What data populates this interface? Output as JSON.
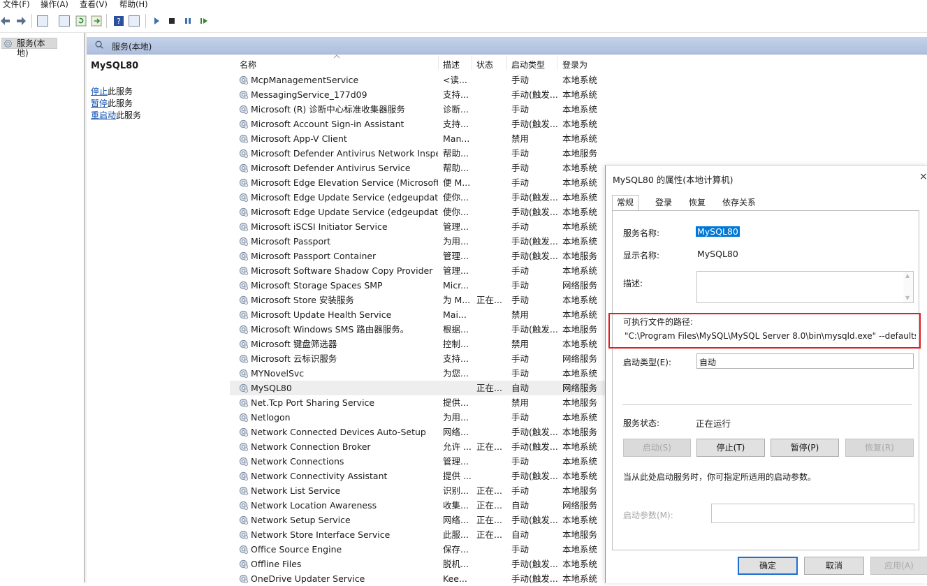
{
  "menu": [
    "文件(F)",
    "操作(A)",
    "查看(V)",
    "帮助(H)"
  ],
  "tree": {
    "root_label": "服务(本地)"
  },
  "main_header": {
    "label": "服务(本地)"
  },
  "detail": {
    "title": "MySQL80",
    "actions": [
      {
        "link": "停止",
        "rest": "此服务"
      },
      {
        "link": "暂停",
        "rest": "此服务"
      },
      {
        "link": "重启动",
        "rest": "此服务"
      }
    ]
  },
  "columns": {
    "name": "名称",
    "desc": "描述",
    "status": "状态",
    "startup": "启动类型",
    "logon": "登录为"
  },
  "rows": [
    {
      "name": "McpManagementService",
      "desc": "<读...",
      "status": "",
      "startup": "手动",
      "logon": "本地系统"
    },
    {
      "name": "MessagingService_177d09",
      "desc": "支持...",
      "status": "",
      "startup": "手动(触发...",
      "logon": "本地系统"
    },
    {
      "name": "Microsoft (R) 诊断中心标准收集器服务",
      "desc": "诊断...",
      "status": "",
      "startup": "手动",
      "logon": "本地系统"
    },
    {
      "name": "Microsoft Account Sign-in Assistant",
      "desc": "支持...",
      "status": "",
      "startup": "手动(触发...",
      "logon": "本地系统"
    },
    {
      "name": "Microsoft App-V Client",
      "desc": "Man...",
      "status": "",
      "startup": "禁用",
      "logon": "本地系统"
    },
    {
      "name": "Microsoft Defender Antivirus Network Inspe...",
      "desc": "帮助...",
      "status": "",
      "startup": "手动",
      "logon": "本地服务"
    },
    {
      "name": "Microsoft Defender Antivirus Service",
      "desc": "帮助...",
      "status": "",
      "startup": "手动",
      "logon": "本地系统"
    },
    {
      "name": "Microsoft Edge Elevation Service (Microsoft...",
      "desc": "便 M...",
      "status": "",
      "startup": "手动",
      "logon": "本地系统"
    },
    {
      "name": "Microsoft Edge Update Service (edgeupdate)",
      "desc": "使你...",
      "status": "",
      "startup": "手动(触发...",
      "logon": "本地系统"
    },
    {
      "name": "Microsoft Edge Update Service (edgeupdat...",
      "desc": "使你...",
      "status": "",
      "startup": "手动(触发...",
      "logon": "本地系统"
    },
    {
      "name": "Microsoft iSCSI Initiator Service",
      "desc": "管理...",
      "status": "",
      "startup": "手动",
      "logon": "本地系统"
    },
    {
      "name": "Microsoft Passport",
      "desc": "为用...",
      "status": "",
      "startup": "手动(触发...",
      "logon": "本地系统"
    },
    {
      "name": "Microsoft Passport Container",
      "desc": "管理...",
      "status": "",
      "startup": "手动(触发...",
      "logon": "本地服务"
    },
    {
      "name": "Microsoft Software Shadow Copy Provider",
      "desc": "管理...",
      "status": "",
      "startup": "手动",
      "logon": "本地系统"
    },
    {
      "name": "Microsoft Storage Spaces SMP",
      "desc": "Micr...",
      "status": "",
      "startup": "手动",
      "logon": "网络服务"
    },
    {
      "name": "Microsoft Store 安装服务",
      "desc": "为 M...",
      "status": "正在...",
      "startup": "手动",
      "logon": "本地系统"
    },
    {
      "name": "Microsoft Update Health Service",
      "desc": "Mai...",
      "status": "",
      "startup": "禁用",
      "logon": "本地系统"
    },
    {
      "name": "Microsoft Windows SMS 路由器服务。",
      "desc": "根据...",
      "status": "",
      "startup": "手动(触发...",
      "logon": "本地服务"
    },
    {
      "name": "Microsoft 键盘筛选器",
      "desc": "控制...",
      "status": "",
      "startup": "禁用",
      "logon": "本地系统"
    },
    {
      "name": "Microsoft 云标识服务",
      "desc": "支持...",
      "status": "",
      "startup": "手动",
      "logon": "网络服务"
    },
    {
      "name": "MYNovelSvc",
      "desc": "为您...",
      "status": "",
      "startup": "手动",
      "logon": "本地系统"
    },
    {
      "name": "MySQL80",
      "desc": "",
      "status": "正在...",
      "startup": "自动",
      "logon": "网络服务"
    },
    {
      "name": "Net.Tcp Port Sharing Service",
      "desc": "提供...",
      "status": "",
      "startup": "禁用",
      "logon": "本地服务"
    },
    {
      "name": "Netlogon",
      "desc": "为用...",
      "status": "",
      "startup": "手动",
      "logon": "本地系统"
    },
    {
      "name": "Network Connected Devices Auto-Setup",
      "desc": "网络...",
      "status": "",
      "startup": "手动(触发...",
      "logon": "本地服务"
    },
    {
      "name": "Network Connection Broker",
      "desc": "允许 ...",
      "status": "正在...",
      "startup": "手动(触发...",
      "logon": "本地系统"
    },
    {
      "name": "Network Connections",
      "desc": "管理...",
      "status": "",
      "startup": "手动",
      "logon": "本地系统"
    },
    {
      "name": "Network Connectivity Assistant",
      "desc": "提供 ...",
      "status": "",
      "startup": "手动(触发...",
      "logon": "本地系统"
    },
    {
      "name": "Network List Service",
      "desc": "识别...",
      "status": "正在...",
      "startup": "手动",
      "logon": "本地服务"
    },
    {
      "name": "Network Location Awareness",
      "desc": "收集...",
      "status": "正在...",
      "startup": "自动",
      "logon": "网络服务"
    },
    {
      "name": "Network Setup Service",
      "desc": "网络...",
      "status": "正在...",
      "startup": "手动(触发...",
      "logon": "本地系统"
    },
    {
      "name": "Network Store Interface Service",
      "desc": "此服...",
      "status": "正在...",
      "startup": "自动",
      "logon": "本地服务"
    },
    {
      "name": "Office  Source Engine",
      "desc": "保存...",
      "status": "",
      "startup": "手动",
      "logon": "本地系统"
    },
    {
      "name": "Offline Files",
      "desc": "脱机...",
      "status": "",
      "startup": "手动(触发...",
      "logon": "本地系统"
    },
    {
      "name": "OneDrive Updater Service",
      "desc": "Kee...",
      "status": "",
      "startup": "手动(触发...",
      "logon": "本地系统"
    }
  ],
  "dialog": {
    "title": "MySQL80 的属性(本地计算机)",
    "close": "×",
    "tabs": [
      "常规",
      "登录",
      "恢复",
      "依存关系"
    ],
    "service_name_label": "服务名称:",
    "service_name_value": "MySQL80",
    "display_name_label": "显示名称:",
    "display_name_value": "MySQL80",
    "description_label": "描述:",
    "path_label": "可执行文件的路径:",
    "path_value": "\"C:\\Program Files\\MySQL\\MySQL Server 8.0\\bin\\mysqld.exe\" --defaults-",
    "startup_type_label": "启动类型(E):",
    "startup_type_value": "自动",
    "status_label": "服务状态:",
    "status_value": "正在运行",
    "btn_start": "启动(S)",
    "btn_stop": "停止(T)",
    "btn_pause": "暂停(P)",
    "btn_resume": "恢复(R)",
    "hint": "当从此处启动服务时，你可指定所适用的启动参数。",
    "param_label": "启动参数(M):",
    "btn_ok": "确定",
    "btn_cancel": "取消",
    "btn_apply": "应用(A)"
  },
  "colors": {
    "header_bg": "#b8c8e4",
    "selection": "#0078d7",
    "highlight_border": "#e02020",
    "link": "#0b4fb2"
  }
}
